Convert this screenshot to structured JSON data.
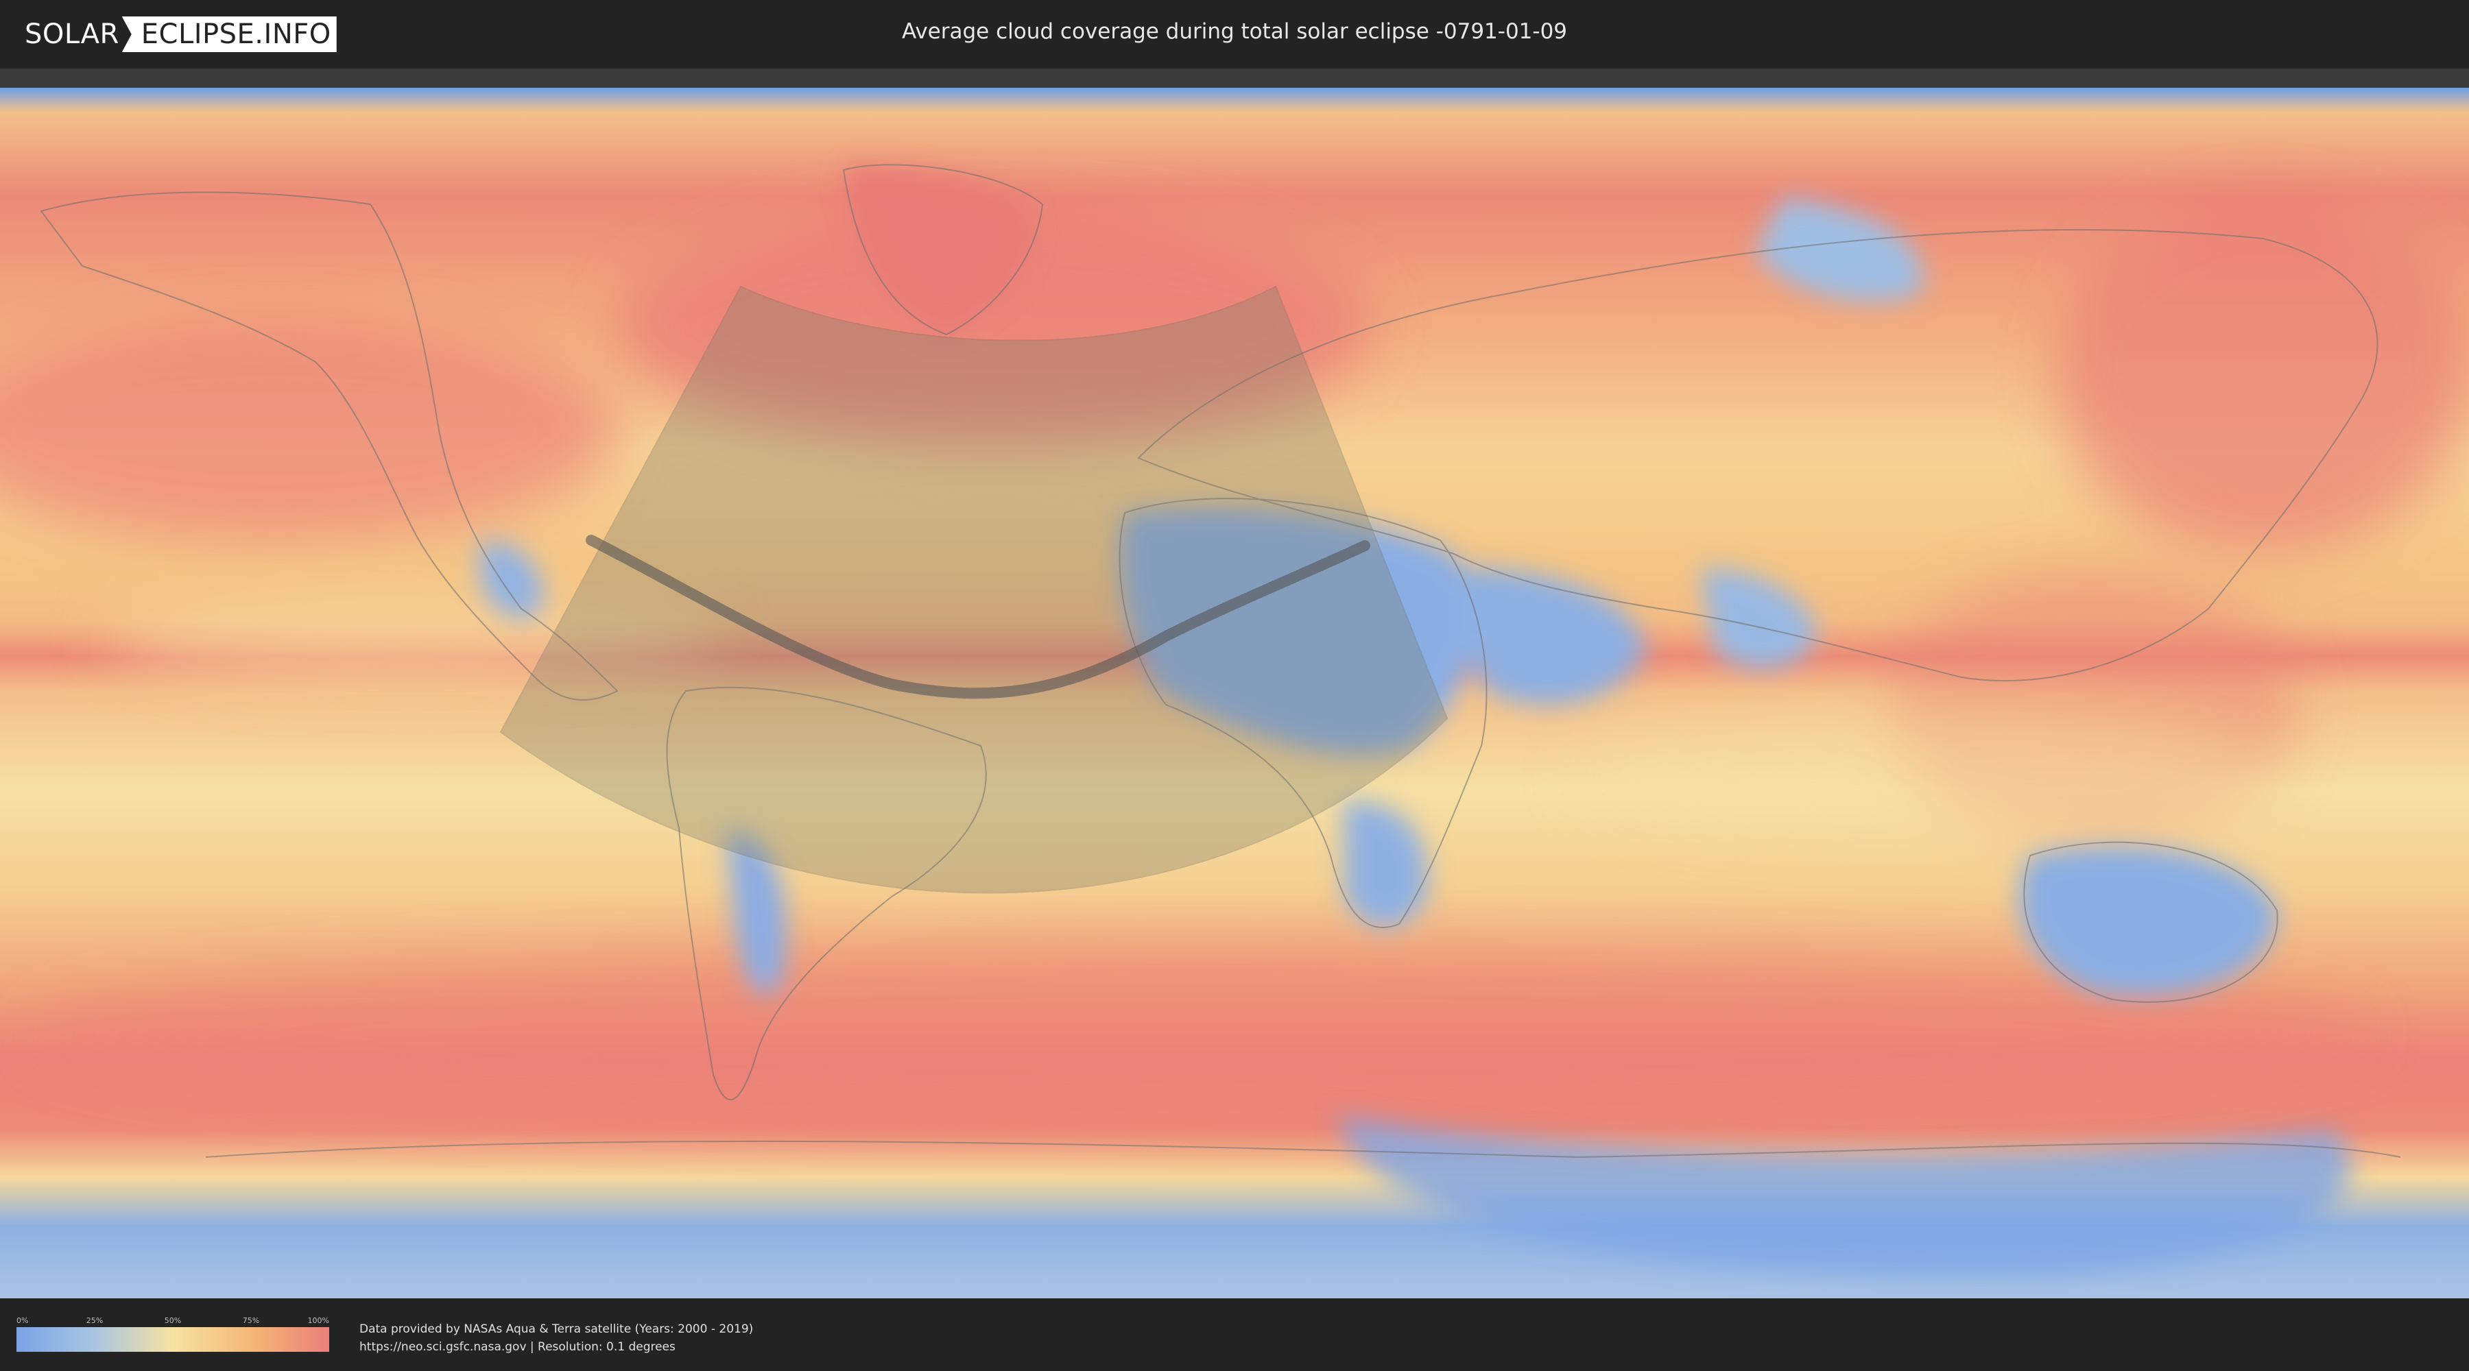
{
  "header": {
    "logo_left": "SOLAR",
    "logo_right": "ECLIPSE.INFO",
    "title": "Average cloud coverage during total solar eclipse -0791-01-09"
  },
  "legend": {
    "ticks": [
      "0%",
      "25%",
      "50%",
      "75%",
      "100%"
    ],
    "tick_fractions": [
      0,
      0.25,
      0.5,
      0.75,
      1
    ],
    "colors": [
      "#7aa3e6",
      "#a9c6e0",
      "#f7e2a2",
      "#f4b877",
      "#ec7f7b"
    ]
  },
  "credits": {
    "line1": "Data provided by NASAs Aqua & Terra satellite (Years: 2000 - 2019)",
    "line2": "https://neo.sci.gsfc.nasa.gov | Resolution: 0.1 degrees"
  },
  "map": {
    "projection": "equirectangular",
    "colors": {
      "ocean_cloudy": "#ec8a78",
      "mid": "#f4c585",
      "clear": "#f6e0a3",
      "dry": "#84a8e2",
      "land_outline": "#6b6b6b",
      "eclipse_zone": "#7d7d6a",
      "eclipse_path": "#555555"
    }
  }
}
